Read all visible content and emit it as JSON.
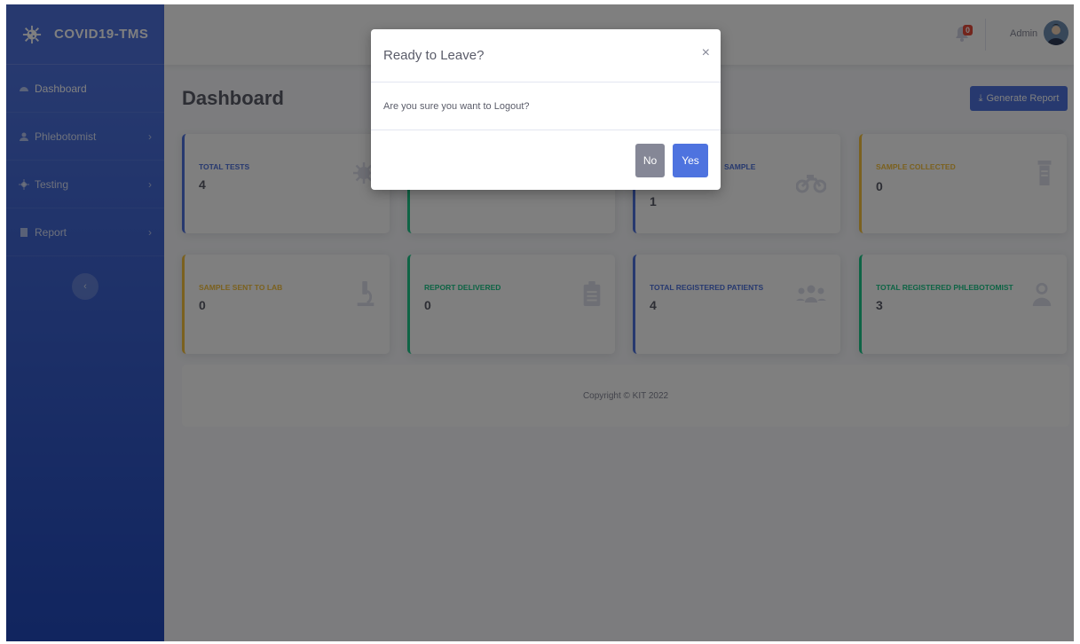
{
  "brand": {
    "name": "COVID19-TMS",
    "icon": "virus-icon"
  },
  "sidebar": {
    "items": [
      {
        "label": "Dashboard",
        "icon": "dashboard-icon"
      },
      {
        "label": "Phlebotomist",
        "icon": "user-md-icon"
      },
      {
        "label": "Testing",
        "icon": "virus-icon"
      },
      {
        "label": "Report",
        "icon": "file-icon"
      }
    ],
    "toggle_icon": "chevron-left-icon"
  },
  "topbar": {
    "notification_count": "0",
    "user_name": "Admin"
  },
  "page": {
    "title": "Dashboard",
    "generate_report_label": "Generate Report"
  },
  "cards": [
    {
      "label": "TOTAL TESTS",
      "value": "4",
      "color": "#4e73df",
      "icon": "virus-icon"
    },
    {
      "label": "",
      "value": "",
      "color": "#1cc88a",
      "icon": ""
    },
    {
      "label": "SAMPLE",
      "value": "1",
      "color": "#4e73df",
      "icon": "motorcycle-icon"
    },
    {
      "label": "SAMPLE COLLECTED",
      "value": "0",
      "color": "#f6c23e",
      "icon": "vial-icon"
    },
    {
      "label": "SAMPLE SENT TO LAB",
      "value": "0",
      "color": "#f6c23e",
      "icon": "microscope-icon"
    },
    {
      "label": "REPORT DELIVERED",
      "value": "0",
      "color": "#1cc88a",
      "icon": "clipboard-icon"
    },
    {
      "label": "TOTAL REGISTERED PATIENTS",
      "value": "4",
      "color": "#4e73df",
      "icon": "users-icon"
    },
    {
      "label": "TOTAL REGISTERED PHLEBOTOMIST",
      "value": "3",
      "color": "#1cc88a",
      "icon": "user-md-icon"
    }
  ],
  "footer": {
    "text": "Copyright © KIT 2022"
  },
  "modal": {
    "title": "Ready to Leave?",
    "close_label": "×",
    "body": "Are you sure you want to Logout?",
    "no_label": "No",
    "yes_label": "Yes"
  }
}
